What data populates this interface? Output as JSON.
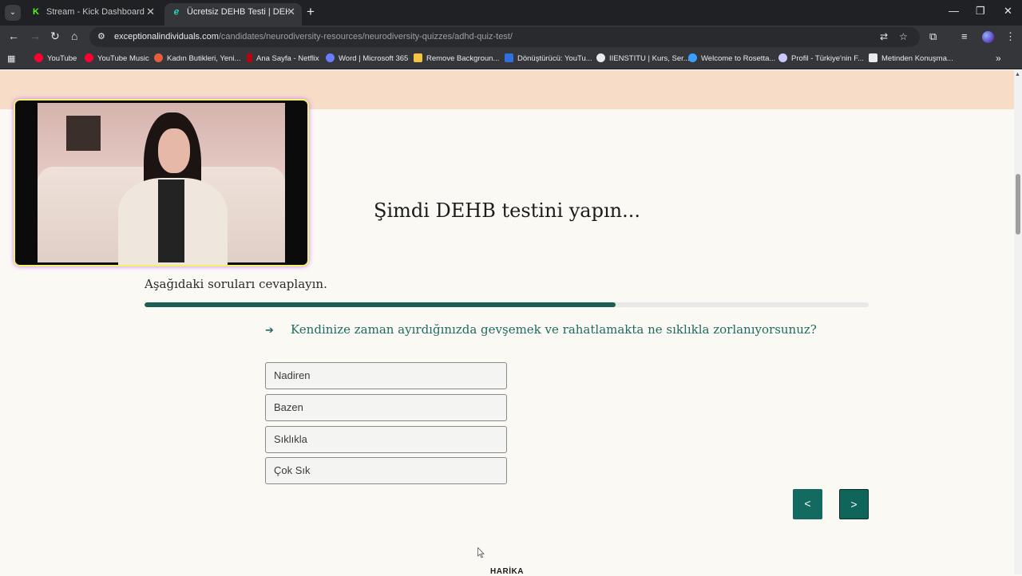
{
  "browser": {
    "tabs": [
      {
        "label": "Stream - Kick Dashboard",
        "icon": "kick-icon",
        "active": false
      },
      {
        "label": "Ücretsiz DEHB Testi | DEHB'im V",
        "icon": "exceptional-individuals-icon",
        "active": true
      }
    ],
    "new_tab": "+",
    "window_controls": {
      "minimize": "—",
      "restore": "❐",
      "close": "✕"
    },
    "url": {
      "host": "exceptionalindividuals.com",
      "path": "/candidates/neurodiversity-resources/neurodiversity-quizzes/adhd-quiz-test/"
    },
    "bookmarks": [
      {
        "label": "YouTube",
        "color": "#ff0033"
      },
      {
        "label": "YouTube Music",
        "color": "#ff0033"
      },
      {
        "label": "Kadın Butikleri, Yeni...",
        "color": "#e85d3a"
      },
      {
        "label": "Ana Sayfa - Netflix",
        "color": "#b20710"
      },
      {
        "label": "Word | Microsoft 365",
        "color": "#6b7cff"
      },
      {
        "label": "Remove Backgroun...",
        "color": "#f5c542"
      },
      {
        "label": "Dönüştürücü: YouTu...",
        "color": "#2f6fe0"
      },
      {
        "label": "IIENSTITU | Kurs, Ser...",
        "color": "#e8eaed"
      },
      {
        "label": "Welcome to Rosetta...",
        "color": "#3aa0ff"
      },
      {
        "label": "Profil - Türkiye'nin F...",
        "color": "#c9c9ff"
      },
      {
        "label": "Metinden Konuşma...",
        "color": "#e8eaed"
      }
    ],
    "bookmarks_more": "»"
  },
  "page": {
    "heading": "Şimdi DEHB testini yapın...",
    "subtext": "Aşağıdaki soruları cevaplayın.",
    "progress_percent": 65,
    "question": "Kendinize zaman ayırdığınızda gevşemek ve rahatlamakta ne sıklıkla zorlanıyorsunuz?",
    "question_arrow": "➔",
    "options": [
      "Nadiren",
      "Bazen",
      "Sıklıkla",
      "Çok Sık"
    ],
    "prev_label": "<",
    "next_label": ">",
    "footer_word": "HARİKA"
  },
  "colors": {
    "accent": "#126a60",
    "question_text": "#1f6a61",
    "hero_band": "#f7dcc8",
    "page_bg": "#faf9f4"
  }
}
